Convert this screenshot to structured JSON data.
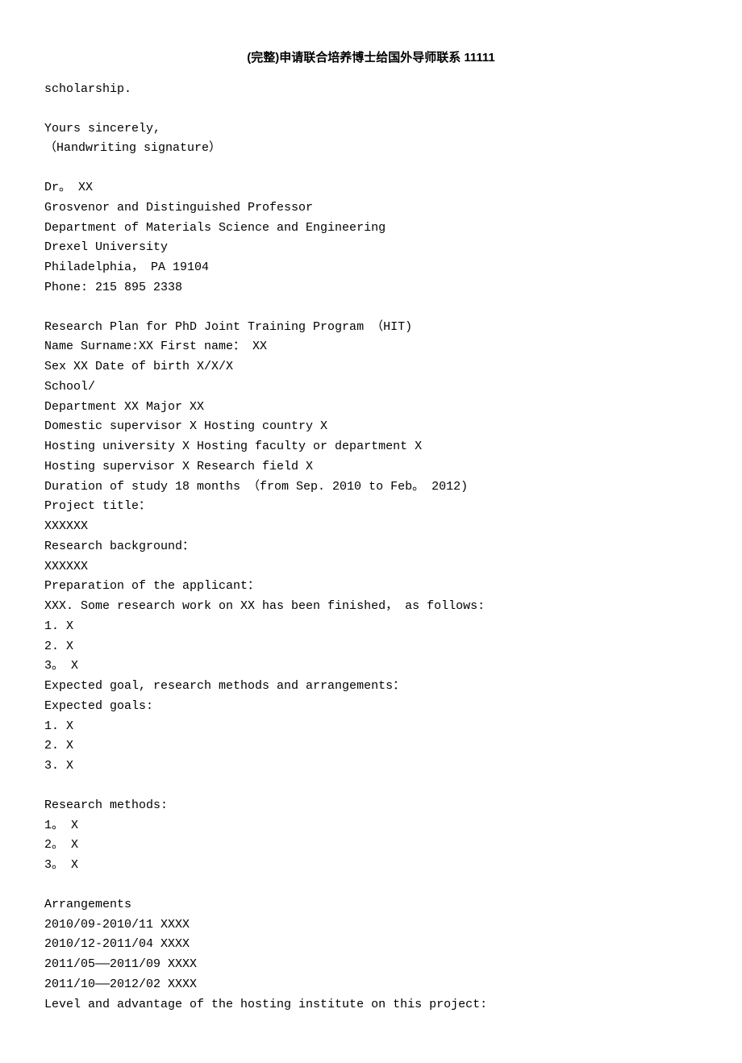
{
  "header": {
    "title": "(完整)申请联合培养博士给国外导师联系 11111"
  },
  "scholarship_line": "scholarship.",
  "closing": {
    "sincerely": "Yours sincerely,",
    "signature": "（Handwriting signature）"
  },
  "signature_block": {
    "name": "Dr。 XX",
    "title": "Grosvenor and Distinguished Professor",
    "department": "Department of Materials Science and Engineering",
    "university": "Drexel University",
    "location": "Philadelphia， PA 19104",
    "phone": "Phone: 215 895 2338"
  },
  "research_plan": {
    "heading": "Research Plan for PhD Joint Training Program （HIT)",
    "name_line": "Name Surname:XX First name： XX",
    "sex_dob": "Sex XX Date of birth X/X/X",
    "school": "School/",
    "dept_major": "Department XX Major XX",
    "domestic": "Domestic supervisor X Hosting country X",
    "hosting_univ": "Hosting university X Hosting faculty or department X",
    "hosting_sup": "Hosting supervisor X Research field X",
    "duration": "Duration of study 18 months （from Sep. 2010 to Feb。 2012)",
    "project_title_label": "Project title：",
    "project_title_val": "XXXXXX",
    "research_bg_label": "Research background：",
    "research_bg_val": "XXXXXX",
    "prep_label": "Preparation of the applicant：",
    "prep_text": "XXX. Some research work on XX has been finished， as follows:",
    "prep_items": [
      "1. X",
      "2. X",
      "3。 X"
    ],
    "expected_label": "Expected goal, research methods and arrangements：",
    "expected_goals_label": "Expected goals:",
    "expected_goals_items": [
      "1. X",
      "2. X",
      "3. X"
    ],
    "methods_label": "Research methods:",
    "methods_items": [
      "1。 X",
      "2。 X",
      "3。 X"
    ],
    "arrangements_label": "Arrangements",
    "arrangements_items": [
      "2010/09-2010/11 XXXX",
      "2010/12-2011/04 XXXX",
      "2011/05——2011/09 XXXX",
      "2011/10——2012/02 XXXX"
    ],
    "level_label": "Level and advantage of the hosting institute on this project:"
  }
}
